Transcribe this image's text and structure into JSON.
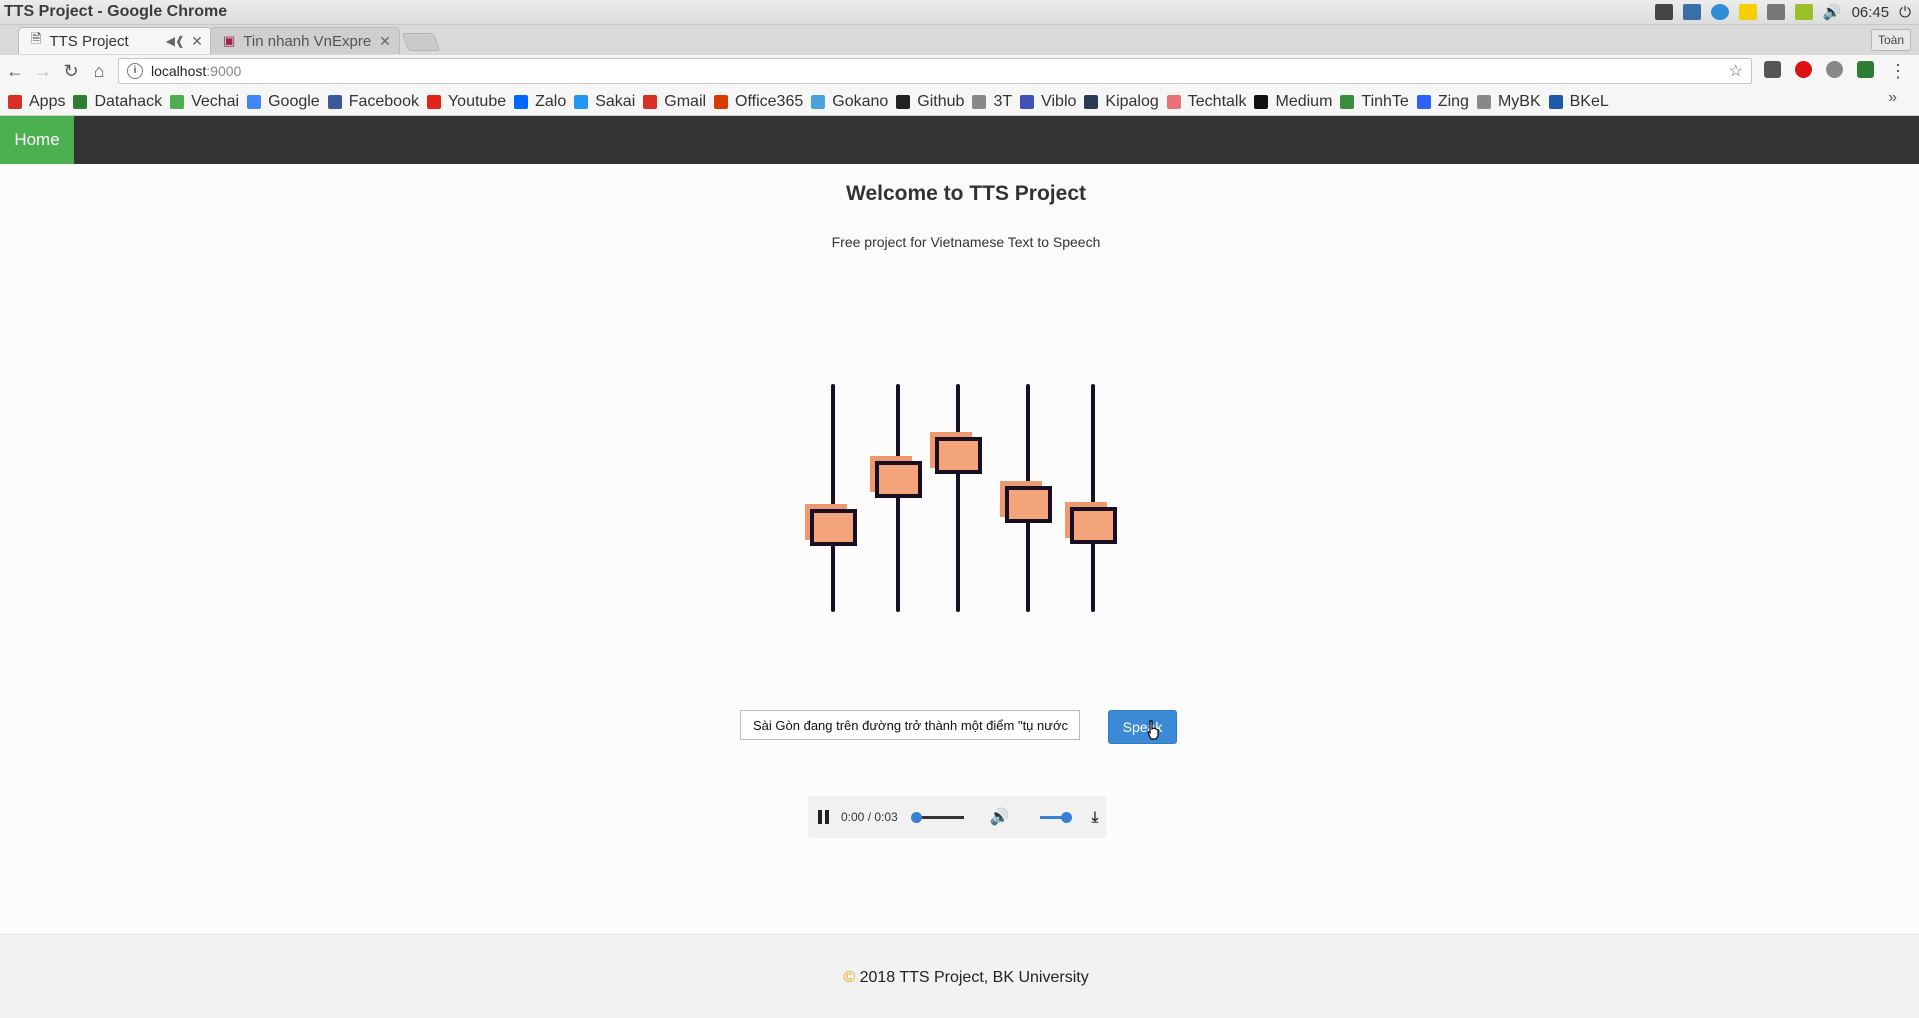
{
  "window": {
    "title": "TTS Project - Google Chrome",
    "clock": "06:45"
  },
  "tabs": [
    {
      "label": "TTS Project",
      "active": true
    },
    {
      "label": "Tin nhanh VnExpre",
      "active": false
    }
  ],
  "profile": "Toàn",
  "address": {
    "host": "localhost",
    "port": ":9000"
  },
  "bookmarks": [
    {
      "label": "Apps",
      "icon": "apps-grid-icon",
      "color": "#d93025"
    },
    {
      "label": "Datahack",
      "icon": "datahack-icon",
      "color": "#2e7d32"
    },
    {
      "label": "Vechai",
      "icon": "vechai-icon",
      "color": "#4caf50"
    },
    {
      "label": "Google",
      "icon": "google-icon",
      "color": "#4285f4"
    },
    {
      "label": "Facebook",
      "icon": "facebook-icon",
      "color": "#3b5998"
    },
    {
      "label": "Youtube",
      "icon": "youtube-icon",
      "color": "#e62117"
    },
    {
      "label": "Zalo",
      "icon": "zalo-icon",
      "color": "#0068ff"
    },
    {
      "label": "Sakai",
      "icon": "sakai-icon",
      "color": "#2196f3"
    },
    {
      "label": "Gmail",
      "icon": "gmail-icon",
      "color": "#d93025"
    },
    {
      "label": "Office365",
      "icon": "office-icon",
      "color": "#d83b01"
    },
    {
      "label": "Gokano",
      "icon": "gokano-icon",
      "color": "#4aa3df"
    },
    {
      "label": "Github",
      "icon": "github-icon",
      "color": "#222222"
    },
    {
      "label": "3T",
      "icon": "page-icon",
      "color": "#888888"
    },
    {
      "label": "Viblo",
      "icon": "viblo-icon",
      "color": "#3f51b5"
    },
    {
      "label": "Kipalog",
      "icon": "kipalog-icon",
      "color": "#2b3a55"
    },
    {
      "label": "Techtalk",
      "icon": "techtalk-icon",
      "color": "#e57373"
    },
    {
      "label": "Medium",
      "icon": "medium-icon",
      "color": "#111111"
    },
    {
      "label": "TinhTe",
      "icon": "tinhte-icon",
      "color": "#388e3c"
    },
    {
      "label": "Zing",
      "icon": "zing-icon",
      "color": "#2962ff"
    },
    {
      "label": "MyBK",
      "icon": "page-icon",
      "color": "#888888"
    },
    {
      "label": "BKeL",
      "icon": "bkel-icon",
      "color": "#1e5aa8"
    }
  ],
  "nav": {
    "home": "Home"
  },
  "main": {
    "title": "Welcome to TTS Project",
    "subtitle": "Free project for Vietnamese Text to Speech",
    "input_value": "Sài Gòn đang trên đường trở thành một điểm \"tụ nước",
    "speak_label": "Speak"
  },
  "player": {
    "time": "0:00 / 0:03",
    "progress": 0,
    "volume": 1
  },
  "footer": {
    "copyright_symbol": "©",
    "text": "2018 TTS Project, BK University"
  },
  "colors": {
    "nav_bg": "#333333",
    "home_bg": "#4caf50",
    "speak_bg": "#3c8ad6",
    "slider_fill": "#f4a47a",
    "slider_shadow": "#ee9a70"
  }
}
